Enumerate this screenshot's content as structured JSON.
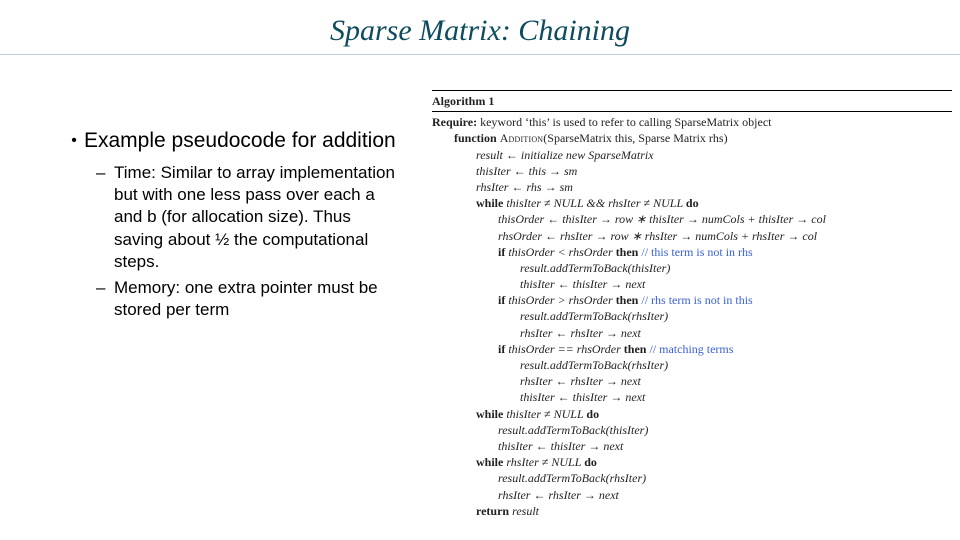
{
  "title": "Sparse Matrix: Chaining",
  "bullet": "Example pseudocode for addition",
  "sub_time": "Time: Similar to array implementation but with one less pass over each a and b (for allocation size). Thus saving about ½ the computational steps.",
  "sub_memory": "Memory: one extra pointer must be stored per term",
  "algo_label": "Algorithm 1",
  "require_kw": "Require:",
  "require_txt": " keyword ‘this’ is used to refer to calling SparseMatrix object",
  "fn_kw": "function",
  "fn_name": "Addition",
  "fn_args": "(SparseMatrix this, Sparse Matrix rhs)",
  "l_result": "result ← initialize new SparseMatrix",
  "l_thisIter": "thisIter ← this → sm",
  "l_rhsIter": "rhsIter ← rhs → sm",
  "while_kw": "while",
  "do_kw": "do",
  "if_kw": "if",
  "then_kw": "then",
  "return_kw": "return",
  "cond_main": " thisIter ≠ NULL   &&   rhsIter ≠ NULL ",
  "l_thisOrder": "thisOrder ← thisIter → row ∗ thisIter → numCols + thisIter → col",
  "l_rhsOrder": "rhsOrder ← rhsIter → row ∗ rhsIter → numCols + rhsIter → col",
  "cond_lt": " thisOrder < rhsOrder ",
  "cmt_lt": "// this term is not in rhs",
  "l_addThis": "result.addTermToBack(thisIter)",
  "l_nextThis": "thisIter ← thisIter → next",
  "cond_gt": " thisOrder > rhsOrder ",
  "cmt_gt": "// rhs term is not in this",
  "l_addRhs": "result.addTermToBack(rhsIter)",
  "l_nextRhs": "rhsIter ← rhsIter → next",
  "cond_eq": " thisOrder == rhsOrder ",
  "cmt_eq": "// matching terms",
  "cond_tail_this": " thisIter ≠ NULL ",
  "cond_tail_rhs": " rhsIter ≠ NULL ",
  "ret_val": "result"
}
